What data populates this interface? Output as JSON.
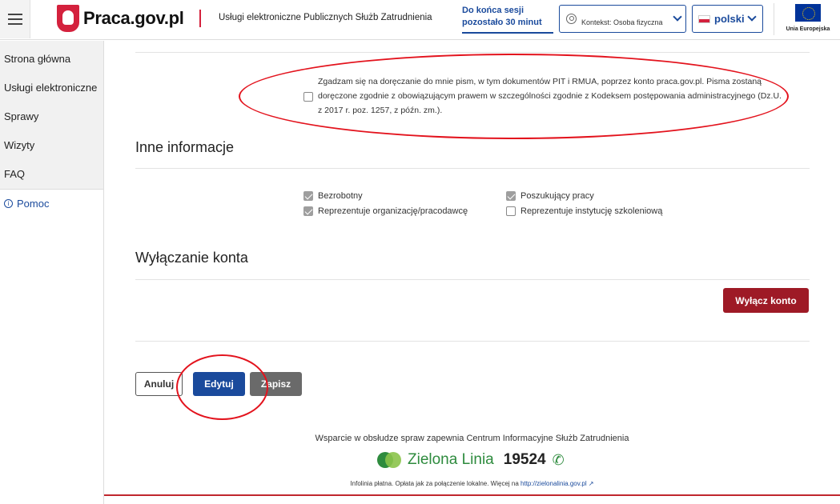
{
  "header": {
    "logo_text": "Praca.gov.pl",
    "subtitle": "Usługi elektroniczne Publicznych Służb Zatrudnienia",
    "session_line1": "Do końca sesji",
    "session_line2": "pozostało 30 minut",
    "context_label": "Kontekst: Osoba fizyczna",
    "language": "polski",
    "eu_label": "Unia Europejska"
  },
  "sidebar": {
    "items": [
      {
        "label": "Strona główna"
      },
      {
        "label": "Usługi elektroniczne"
      },
      {
        "label": "Sprawy"
      },
      {
        "label": "Wizyty"
      },
      {
        "label": "FAQ"
      }
    ],
    "help_label": "Pomoc"
  },
  "consent": {
    "text": "Zgadzam się na doręczanie do mnie pism, w tym dokumentów PIT i RMUA, poprzez konto praca.gov.pl. Pisma zostaną doręczone zgodnie z obowiązującym prawem w szczególności zgodnie z Kodeksem postępowania administracyjnego (Dz.U. z 2017 r. poz. 1257, z późn. zm.).",
    "checked": false
  },
  "other_info": {
    "title": "Inne informacje",
    "options": [
      {
        "label": "Bezrobotny",
        "checked": true
      },
      {
        "label": "Poszukujący pracy",
        "checked": true
      },
      {
        "label": "Reprezentuje organizację/pracodawcę",
        "checked": true
      },
      {
        "label": "Reprezentuje instytucję szkoleniową",
        "checked": false
      }
    ]
  },
  "account": {
    "title": "Wyłączanie konta",
    "disable_label": "Wyłącz konto"
  },
  "actions": {
    "cancel_label": "Anuluj",
    "edit_label": "Edytuj",
    "save_label": "Zapisz"
  },
  "footer": {
    "support_text": "Wsparcie w obsłudze spraw zapewnia Centrum Informacyjne Służb Zatrudnienia",
    "line_name": "Zielona Linia",
    "line_number": "19524",
    "fine_text": "Infolinia płatna. Opłata jak za połączenie lokalne. Więcej na",
    "fine_link": "http://zielonalinia.gov.pl"
  },
  "colors": {
    "primary": "#1a4a9c",
    "danger": "#9e1a26",
    "annotation": "#e3131d",
    "green": "#2e8b3e"
  }
}
